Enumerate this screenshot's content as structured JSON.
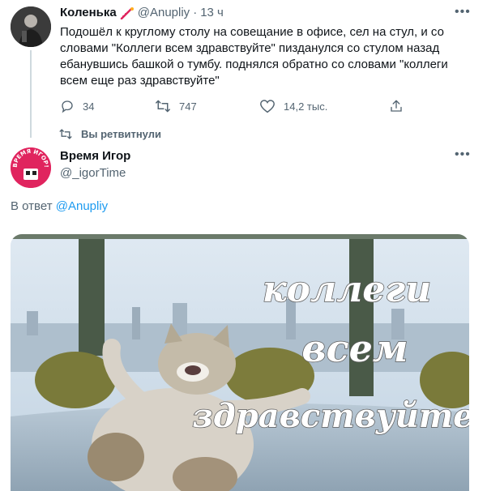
{
  "parent_tweet": {
    "display_name": "Коленька",
    "handle": "@Anupliy",
    "separator": "·",
    "time": "13 ч",
    "text": "Подошёл к круглому столу на совещание в офисе, сел на стул, и со словами \"Коллеги всем здравствуйте\" пизданулся со стулом назад ебанувшись башкой о тумбу. поднялся обратно со словами \"коллеги всем еще раз здравствуйте\"",
    "replies": "34",
    "retweets": "747",
    "likes": "14,2 тыс.",
    "retweeted_label": "Вы ретвитнули"
  },
  "reply_tweet": {
    "display_name": "Время Игор",
    "handle": "@_igorTime",
    "reply_prefix": "В ответ",
    "reply_to": "@Anupliy",
    "avatar_text": "ВРЕМЯ ИГОР!",
    "image_caption": [
      "коллеги",
      "всем",
      "здравствуйте"
    ]
  },
  "colors": {
    "accent": "#1d9bf0",
    "muted": "#536471",
    "thread_line": "#cfd9de"
  }
}
